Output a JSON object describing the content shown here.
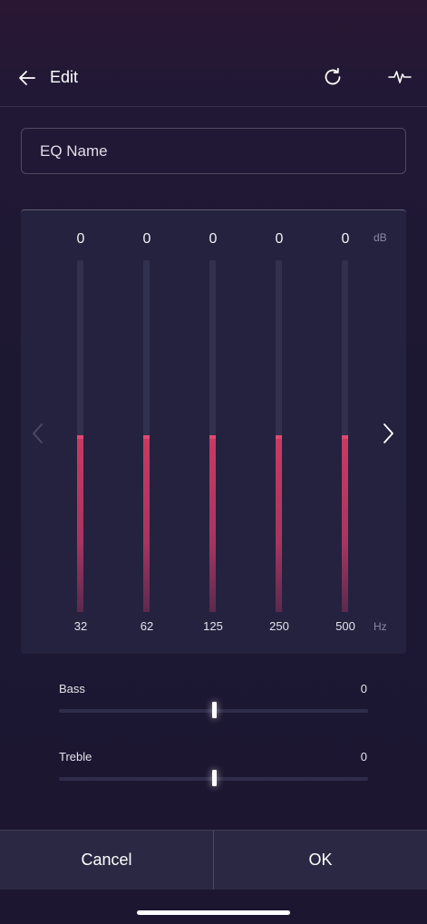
{
  "header": {
    "title": "Edit",
    "back_icon": "arrow-left-icon",
    "reset_icon": "refresh-icon",
    "wave_icon": "waveform-icon"
  },
  "eq_name": {
    "value": "",
    "placeholder": "EQ Name"
  },
  "equalizer": {
    "db_unit": "dB",
    "hz_unit": "Hz",
    "range_db": [
      -12,
      12
    ],
    "bands": [
      {
        "freq": "32",
        "value": "0",
        "level": 0
      },
      {
        "freq": "62",
        "value": "0",
        "level": 0
      },
      {
        "freq": "125",
        "value": "0",
        "level": 0
      },
      {
        "freq": "250",
        "value": "0",
        "level": 0
      },
      {
        "freq": "500",
        "value": "0",
        "level": 0
      }
    ],
    "prev_icon": "chevron-left-icon",
    "next_icon": "chevron-right-icon"
  },
  "tone": {
    "bass": {
      "label": "Bass",
      "value": "0",
      "level": 0.5
    },
    "treble": {
      "label": "Treble",
      "value": "0",
      "level": 0.5
    }
  },
  "footer": {
    "cancel_label": "Cancel",
    "ok_label": "OK"
  },
  "colors": {
    "accent": "#c93a62",
    "background": "#1d1832",
    "panel": "#24223f",
    "footer": "#2b2844"
  }
}
